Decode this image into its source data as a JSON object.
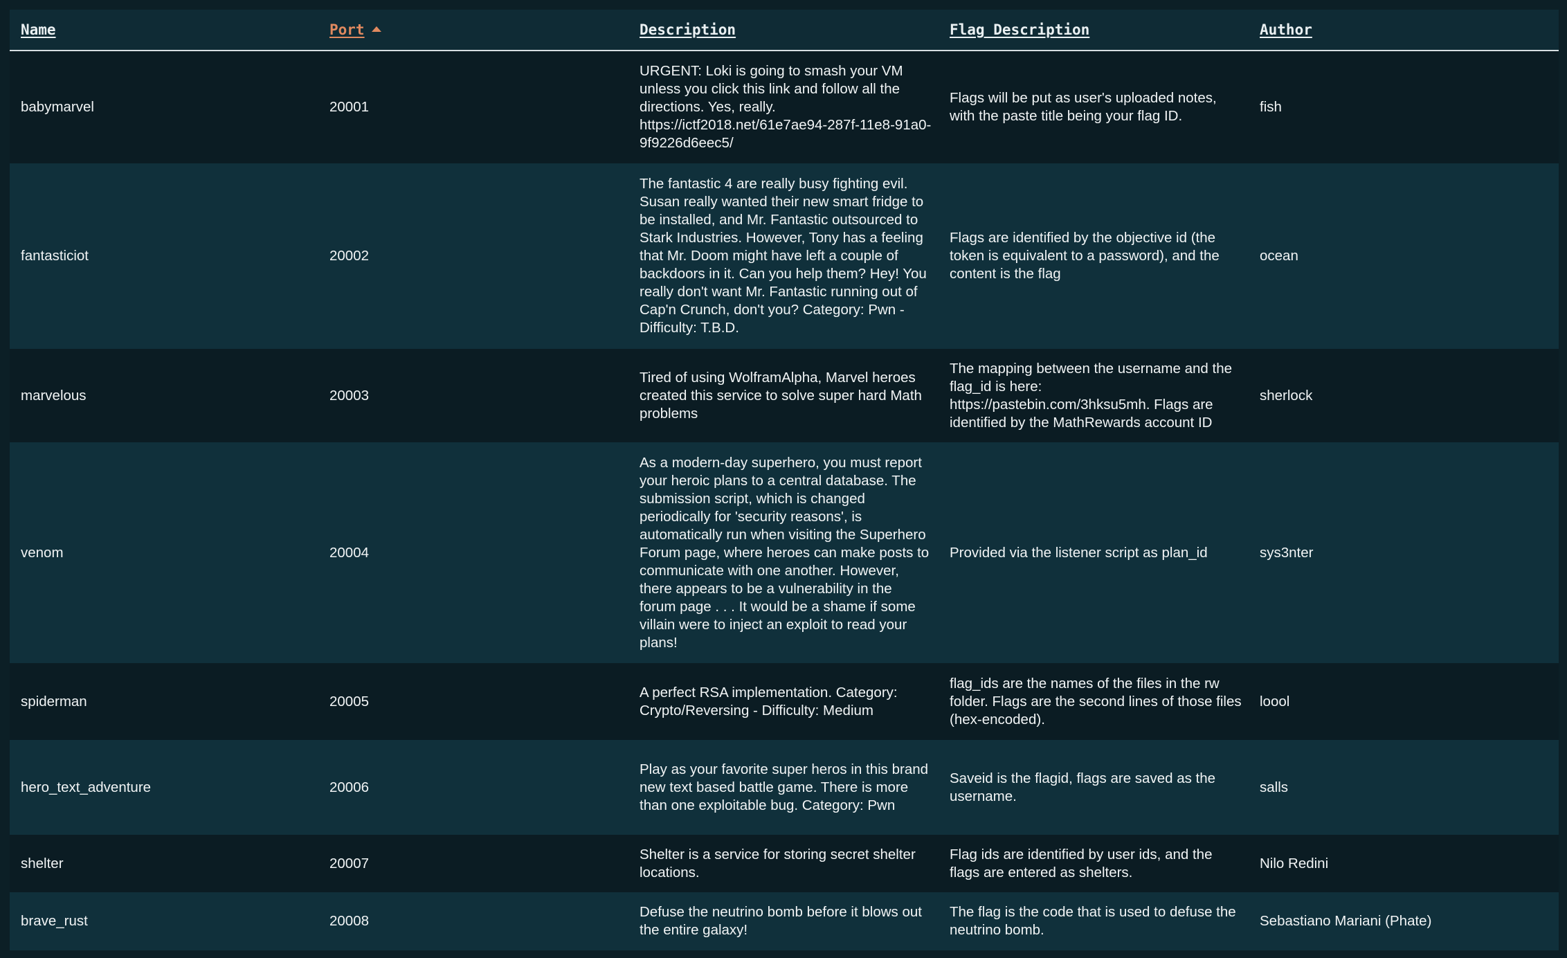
{
  "table": {
    "headers": {
      "name": "Name",
      "port": "Port",
      "description": "Description",
      "flag_description": "Flag Description",
      "author": "Author"
    },
    "sort": {
      "column": "port",
      "direction": "ascending"
    },
    "colors": {
      "header_link": "#eaf0f2",
      "sorted_header": "#e0895f",
      "row_dark": "#0b1c23",
      "row_light": "#10303b"
    },
    "rows": [
      {
        "name": "babymarvel",
        "port": "20001",
        "description": "URGENT: Loki is going to smash your VM unless you click this link and follow all the directions. Yes, really. https://ictf2018.net/61e7ae94-287f-11e8-91a0-9f9226d6eec5/",
        "flag_description": "Flags will be put as user's uploaded notes, with the paste title being your flag ID.",
        "author": "fish"
      },
      {
        "name": "fantasticiot",
        "port": "20002",
        "description": "The fantastic 4 are really busy fighting evil. Susan really wanted their new smart fridge to be installed, and Mr. Fantastic outsourced to Stark Industries. However, Tony has a feeling that Mr. Doom might have left a couple of backdoors in it. Can you help them? Hey! You really don't want Mr. Fantastic running out of Cap'n Crunch, don't you? Category: Pwn - Difficulty: T.B.D.",
        "flag_description": "Flags are identified by the objective id (the token is equivalent to a password), and the content is the flag",
        "author": "ocean"
      },
      {
        "name": "marvelous",
        "port": "20003",
        "description": "Tired of using WolframAlpha, Marvel heroes created this service to solve super hard Math problems",
        "flag_description": "The mapping between the username and the flag_id is here: https://pastebin.com/3hksu5mh. Flags are identified by the MathRewards account ID",
        "author": "sherlock"
      },
      {
        "name": "venom",
        "port": "20004",
        "description": "As a modern-day superhero, you must report your heroic plans to a central database. The submission script, which is changed periodically for 'security reasons', is automatically run when visiting the Superhero Forum page, where heroes can make posts to communicate with one another. However, there appears to be a vulnerability in the forum page . . . It would be a shame if some villain were to inject an exploit to read your plans!",
        "flag_description": "Provided via the listener script as plan_id",
        "author": "sys3nter"
      },
      {
        "name": "spiderman",
        "port": "20005",
        "description": "A perfect RSA implementation. Category: Crypto/Reversing - Difficulty: Medium",
        "flag_description": "flag_ids are the names of the files in the rw folder. Flags are the second lines of those files (hex-encoded).",
        "author": "loool"
      },
      {
        "name": "hero_text_adventure",
        "port": "20006",
        "description": "Play as your favorite super heros in this brand new text based battle game. There is more than one exploitable bug. Category: Pwn",
        "flag_description": "Saveid is the flagid, flags are saved as the username.",
        "author": "salls"
      },
      {
        "name": "shelter",
        "port": "20007",
        "description": "Shelter is a service for storing secret shelter locations.",
        "flag_description": "Flag ids are identified by user ids, and the flags are entered as shelters.",
        "author": "Nilo Redini"
      },
      {
        "name": "brave_rust",
        "port": "20008",
        "description": "Defuse the neutrino bomb before it blows out the entire galaxy!",
        "flag_description": "The flag is the code that is used to defuse the neutrino bomb.",
        "author": "Sebastiano Mariani (Phate)"
      }
    ]
  }
}
